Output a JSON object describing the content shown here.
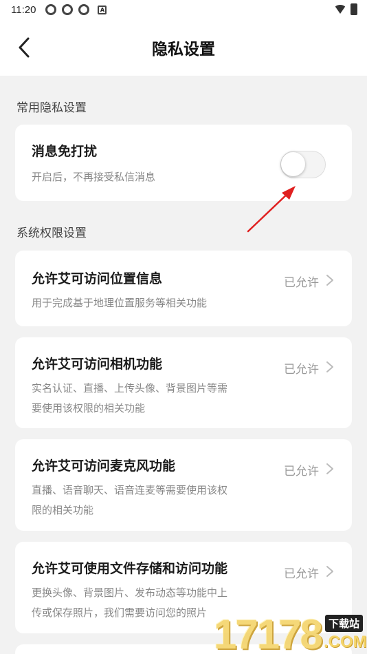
{
  "status_bar": {
    "time": "11:20",
    "a_badge": "A",
    "icons": [
      "app-icon",
      "app-icon",
      "app-icon",
      "wifi-icon",
      "battery-icon"
    ]
  },
  "header": {
    "title": "隐私设置",
    "back_icon": "chevron-left-icon"
  },
  "sections": {
    "common": {
      "title": "常用隐私设置",
      "dnd": {
        "title": "消息免打扰",
        "desc": "开启后，不再接受私信消息",
        "enabled": false
      }
    },
    "system": {
      "title": "系统权限设置",
      "items": [
        {
          "title": "允许艾可访问位置信息",
          "status": "已允许",
          "desc_lines": [
            "用于完成基于地理位置服务等相关功能"
          ]
        },
        {
          "title": "允许艾可访问相机功能",
          "status": "已允许",
          "desc_lines": [
            "实名认证、直播、上传头像、背景图片等需",
            "要使用该权限的相关功能"
          ]
        },
        {
          "title": "允许艾可访问麦克风功能",
          "status": "已允许",
          "desc_lines": [
            "直播、语音聊天、语音连麦等需要使用该权",
            "限的相关功能"
          ]
        },
        {
          "title": "允许艾可使用文件存储和访问功能",
          "status": "已允许",
          "desc_lines": [
            "更换头像、背景图片、发布动态等功能中上",
            "传或保存照片，我们需要访问您的照片"
          ]
        }
      ]
    }
  },
  "watermark": {
    "digits": "17178",
    "badge": "下载站",
    "domain": ".COM"
  },
  "colors": {
    "background": "#f2f2f2",
    "card": "#ffffff",
    "annotation_arrow": "#e02020"
  }
}
